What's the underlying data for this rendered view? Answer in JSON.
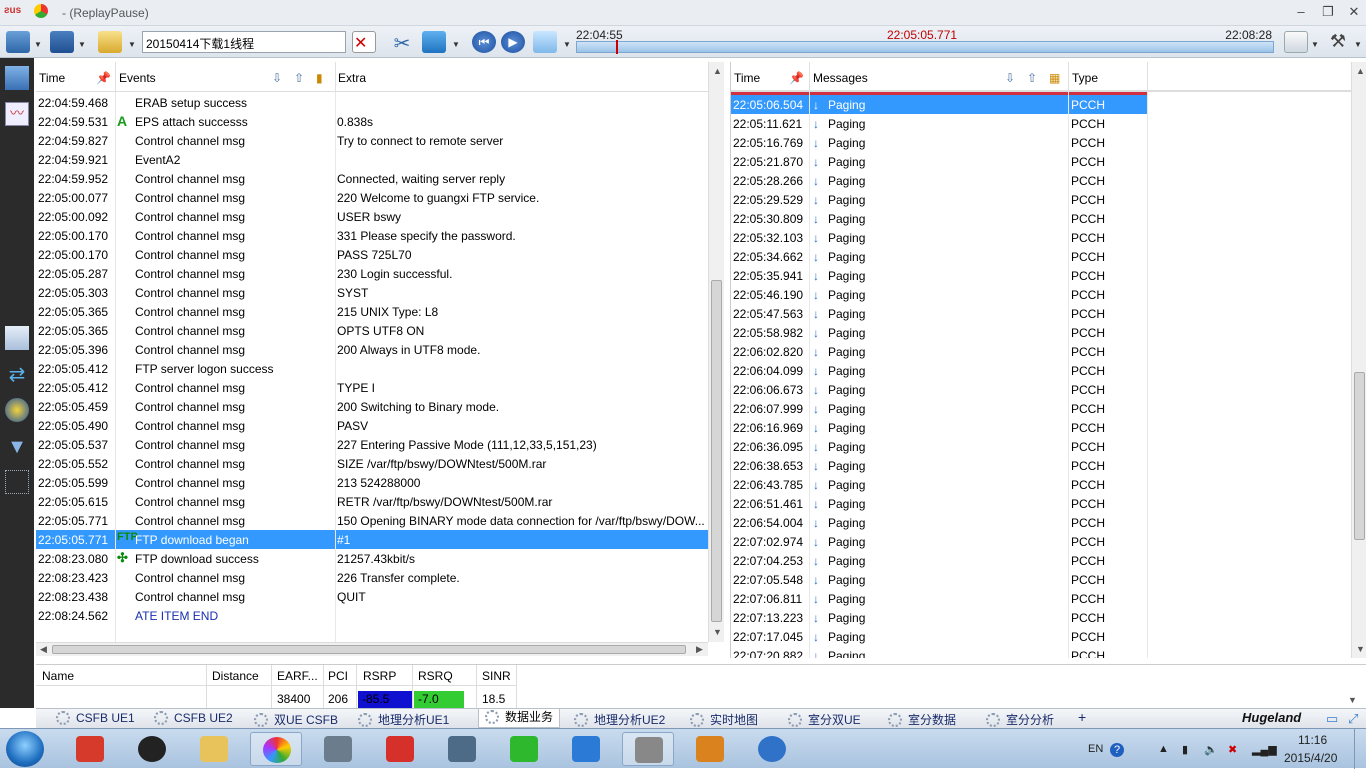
{
  "window": {
    "title": "- (ReplayPause)"
  },
  "toolbar": {
    "filename": "20150414下载1线程"
  },
  "timeline": {
    "start": "22:04:55",
    "current": "22:05:05.771",
    "end": "22:08:28",
    "progress": 0.058
  },
  "events_panel": {
    "headers": {
      "time": "Time",
      "events": "Events",
      "extra": "Extra"
    },
    "rows": [
      {
        "time": "22:04:59.468",
        "event": "ERAB setup success",
        "extra": "",
        "icon": ""
      },
      {
        "time": "22:04:59.531",
        "event": "EPS attach successs",
        "extra": "0.838s",
        "icon": "attach-a-icon"
      },
      {
        "time": "22:04:59.827",
        "event": "Control channel msg",
        "extra": "Try to connect to remote server",
        "icon": ""
      },
      {
        "time": "22:04:59.921",
        "event": "EventA2",
        "extra": "",
        "icon": ""
      },
      {
        "time": "22:04:59.952",
        "event": "Control channel msg",
        "extra": "Connected, waiting server reply",
        "icon": ""
      },
      {
        "time": "22:05:00.077",
        "event": "Control channel msg",
        "extra": "220 Welcome to guangxi FTP service.",
        "icon": ""
      },
      {
        "time": "22:05:00.092",
        "event": "Control channel msg",
        "extra": "USER bswy",
        "icon": ""
      },
      {
        "time": "22:05:00.170",
        "event": "Control channel msg",
        "extra": "331 Please specify the password.",
        "icon": ""
      },
      {
        "time": "22:05:00.170",
        "event": "Control channel msg",
        "extra": "PASS 725L70",
        "icon": ""
      },
      {
        "time": "22:05:05.287",
        "event": "Control channel msg",
        "extra": "230 Login successful.",
        "icon": ""
      },
      {
        "time": "22:05:05.303",
        "event": "Control channel msg",
        "extra": "SYST",
        "icon": ""
      },
      {
        "time": "22:05:05.365",
        "event": "Control channel msg",
        "extra": "215 UNIX Type: L8",
        "icon": ""
      },
      {
        "time": "22:05:05.365",
        "event": "Control channel msg",
        "extra": "OPTS UTF8 ON",
        "icon": ""
      },
      {
        "time": "22:05:05.396",
        "event": "Control channel msg",
        "extra": "200 Always in UTF8 mode.",
        "icon": ""
      },
      {
        "time": "22:05:05.412",
        "event": "FTP server logon success",
        "extra": "",
        "icon": ""
      },
      {
        "time": "22:05:05.412",
        "event": "Control channel msg",
        "extra": "TYPE I",
        "icon": ""
      },
      {
        "time": "22:05:05.459",
        "event": "Control channel msg",
        "extra": "200 Switching to Binary mode.",
        "icon": ""
      },
      {
        "time": "22:05:05.490",
        "event": "Control channel msg",
        "extra": "PASV",
        "icon": ""
      },
      {
        "time": "22:05:05.537",
        "event": "Control channel msg",
        "extra": "227 Entering Passive Mode (111,12,33,5,151,23)",
        "icon": ""
      },
      {
        "time": "22:05:05.552",
        "event": "Control channel msg",
        "extra": "SIZE /var/ftp/bswy/DOWNtest/500M.rar",
        "icon": ""
      },
      {
        "time": "22:05:05.599",
        "event": "Control channel msg",
        "extra": "213 524288000",
        "icon": ""
      },
      {
        "time": "22:05:05.615",
        "event": "Control channel msg",
        "extra": "RETR /var/ftp/bswy/DOWNtest/500M.rar",
        "icon": ""
      },
      {
        "time": "22:05:05.771",
        "event": "Control channel msg",
        "extra": "150 Opening BINARY mode data connection for /var/ftp/bswy/DOW...",
        "icon": ""
      },
      {
        "time": "22:05:05.771",
        "event": "FTP download began",
        "extra": "#1",
        "icon": "ftp-icon",
        "selected": true
      },
      {
        "time": "22:08:23.080",
        "event": "FTP download success",
        "extra": "21257.43kbit/s",
        "icon": "ftp-success-icon"
      },
      {
        "time": "22:08:23.423",
        "event": "Control channel msg",
        "extra": "226 Transfer complete.",
        "icon": ""
      },
      {
        "time": "22:08:23.438",
        "event": "Control channel msg",
        "extra": "QUIT",
        "icon": ""
      },
      {
        "time": "22:08:24.562",
        "event": "ATE ITEM END",
        "extra": "",
        "icon": "",
        "blue": true
      }
    ]
  },
  "messages_panel": {
    "headers": {
      "time": "Time",
      "messages": "Messages",
      "type": "Type"
    },
    "rows": [
      {
        "time": "22:05:06.504",
        "message": "Paging",
        "type": "PCCH",
        "selected": true
      },
      {
        "time": "22:05:11.621",
        "message": "Paging",
        "type": "PCCH"
      },
      {
        "time": "22:05:16.769",
        "message": "Paging",
        "type": "PCCH"
      },
      {
        "time": "22:05:21.870",
        "message": "Paging",
        "type": "PCCH"
      },
      {
        "time": "22:05:28.266",
        "message": "Paging",
        "type": "PCCH"
      },
      {
        "time": "22:05:29.529",
        "message": "Paging",
        "type": "PCCH"
      },
      {
        "time": "22:05:30.809",
        "message": "Paging",
        "type": "PCCH"
      },
      {
        "time": "22:05:32.103",
        "message": "Paging",
        "type": "PCCH"
      },
      {
        "time": "22:05:34.662",
        "message": "Paging",
        "type": "PCCH"
      },
      {
        "time": "22:05:35.941",
        "message": "Paging",
        "type": "PCCH"
      },
      {
        "time": "22:05:46.190",
        "message": "Paging",
        "type": "PCCH"
      },
      {
        "time": "22:05:47.563",
        "message": "Paging",
        "type": "PCCH"
      },
      {
        "time": "22:05:58.982",
        "message": "Paging",
        "type": "PCCH"
      },
      {
        "time": "22:06:02.820",
        "message": "Paging",
        "type": "PCCH"
      },
      {
        "time": "22:06:04.099",
        "message": "Paging",
        "type": "PCCH"
      },
      {
        "time": "22:06:06.673",
        "message": "Paging",
        "type": "PCCH"
      },
      {
        "time": "22:06:07.999",
        "message": "Paging",
        "type": "PCCH"
      },
      {
        "time": "22:06:16.969",
        "message": "Paging",
        "type": "PCCH"
      },
      {
        "time": "22:06:36.095",
        "message": "Paging",
        "type": "PCCH"
      },
      {
        "time": "22:06:38.653",
        "message": "Paging",
        "type": "PCCH"
      },
      {
        "time": "22:06:43.785",
        "message": "Paging",
        "type": "PCCH"
      },
      {
        "time": "22:06:51.461",
        "message": "Paging",
        "type": "PCCH"
      },
      {
        "time": "22:06:54.004",
        "message": "Paging",
        "type": "PCCH"
      },
      {
        "time": "22:07:02.974",
        "message": "Paging",
        "type": "PCCH"
      },
      {
        "time": "22:07:04.253",
        "message": "Paging",
        "type": "PCCH"
      },
      {
        "time": "22:07:05.548",
        "message": "Paging",
        "type": "PCCH"
      },
      {
        "time": "22:07:06.811",
        "message": "Paging",
        "type": "PCCH"
      },
      {
        "time": "22:07:13.223",
        "message": "Paging",
        "type": "PCCH"
      },
      {
        "time": "22:07:17.045",
        "message": "Paging",
        "type": "PCCH"
      },
      {
        "time": "22:07:20.882",
        "message": "Paging",
        "type": "PCCH"
      }
    ]
  },
  "cell_info": {
    "headers": {
      "name": "Name",
      "distance": "Distance",
      "earfcn": "EARF...",
      "pci": "PCI",
      "rsrp": "RSRP",
      "rsrq": "RSRQ",
      "sinr": "SINR"
    },
    "values": {
      "name": "",
      "distance": "",
      "earfcn": "38400",
      "pci": "206",
      "rsrp": "-85.5",
      "rsrq": "-7.0",
      "sinr": "18.5"
    },
    "colors": {
      "rsrp": "#1010d0",
      "rsrq": "#33cc33"
    }
  },
  "tabs": [
    {
      "label": "CSFB UE1"
    },
    {
      "label": "CSFB UE2"
    },
    {
      "label": "双UE  CSFB"
    },
    {
      "label": "地理分析UE1"
    },
    {
      "label": "数据业务",
      "active": true
    },
    {
      "label": "地理分析UE2"
    },
    {
      "label": "实时地图"
    },
    {
      "label": "室分双UE"
    },
    {
      "label": "室分数据"
    },
    {
      "label": "室分分析"
    }
  ],
  "tab_add": "+",
  "brand": "Hugeland",
  "taskbar": {
    "apps": [
      "start-orb",
      "app-red",
      "qq",
      "explorer",
      "picasa",
      "camera",
      "foxit",
      "shield",
      "wechat",
      "network",
      "cds",
      "books",
      "earth"
    ],
    "lang": "EN",
    "time": "11:16",
    "date": "2015/4/20"
  },
  "colors": {
    "selection": "#3399ff",
    "accent_red": "#c00000",
    "left_bar": "#2b2b2b"
  }
}
